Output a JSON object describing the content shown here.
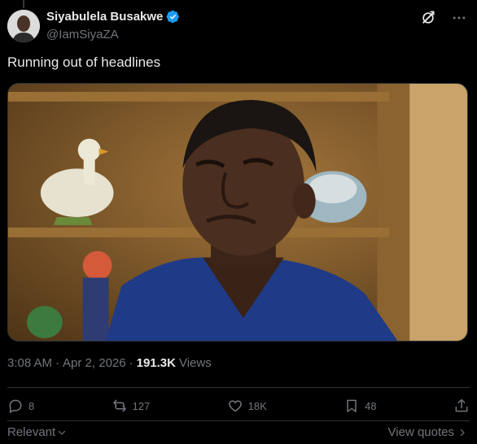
{
  "post": {
    "author_name": "Siyabulela Busakwe",
    "author_handle": "@IamSiyaZA",
    "text": "Running out of headlines",
    "time": "3:08 AM",
    "date": "Apr 2, 2026",
    "separator": "·",
    "views_count": "191.3K",
    "views_label": "Views",
    "verified": true
  },
  "actions": {
    "replies": "8",
    "reposts": "127",
    "likes": "18K",
    "bookmarks": "48"
  },
  "footer": {
    "sort_label": "Relevant",
    "view_quotes": "View quotes"
  },
  "colors": {
    "background": "#000000",
    "text": "#e7e9ea",
    "secondary": "#71767b",
    "verified": "#1d9bf0",
    "border": "#2f3336"
  },
  "icons": {
    "top_right": [
      "grok-icon",
      "more-icon"
    ],
    "actions": [
      "reply-icon",
      "repost-icon",
      "like-icon",
      "bookmark-icon",
      "share-icon"
    ]
  }
}
